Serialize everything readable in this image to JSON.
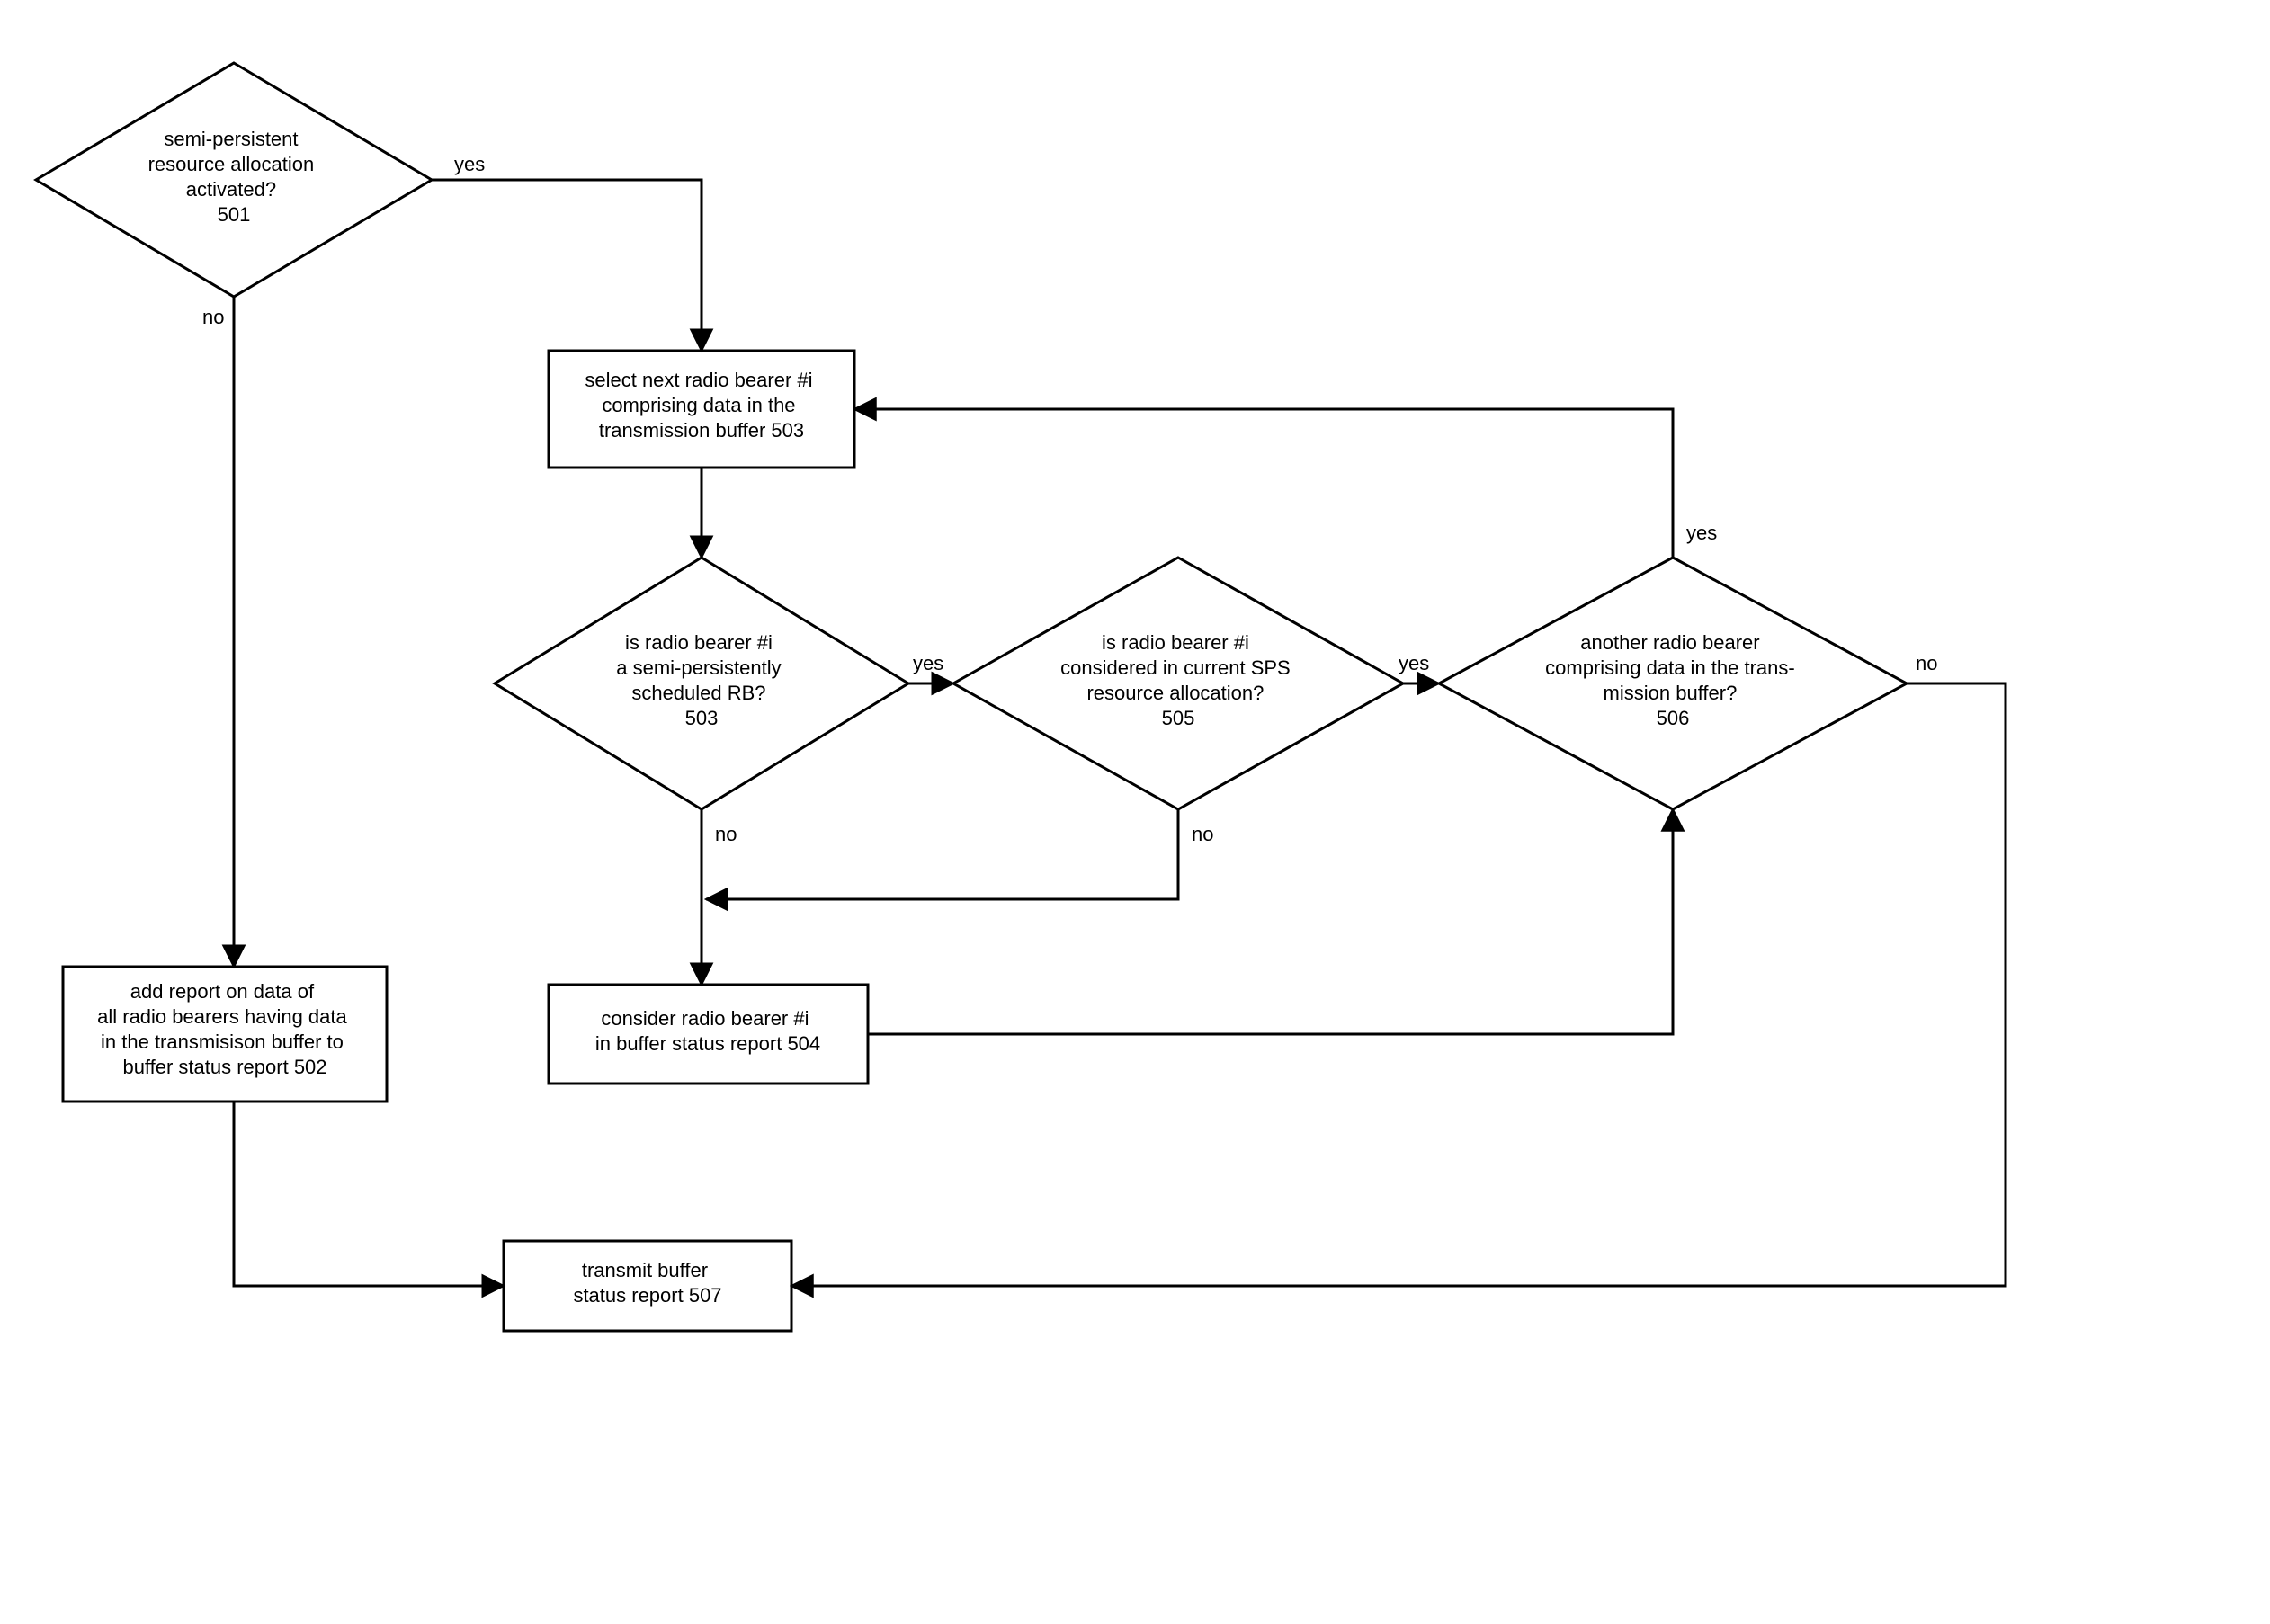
{
  "chart_data": {
    "type": "flowchart",
    "nodes": [
      {
        "id": "501",
        "shape": "diamond",
        "lines": [
          "semi-persistent",
          "resource allocation",
          "activated?",
          "501"
        ]
      },
      {
        "id": "502",
        "shape": "rect",
        "lines": [
          "add report on data of",
          "all radio bearers having data",
          "in the transmisison buffer to",
          "buffer status report 502"
        ]
      },
      {
        "id": "503p",
        "shape": "rect",
        "lines": [
          "select next radio bearer #i",
          "comprising data in the",
          "transmission buffer 503"
        ]
      },
      {
        "id": "503d",
        "shape": "diamond",
        "lines": [
          "is radio bearer #i",
          "a semi-persistently",
          "scheduled RB?",
          "503"
        ]
      },
      {
        "id": "505",
        "shape": "diamond",
        "lines": [
          "is radio bearer #i",
          "considered in current SPS",
          "resource allocation?",
          "505"
        ]
      },
      {
        "id": "506",
        "shape": "diamond",
        "lines": [
          "another radio bearer",
          "comprising data in the trans-",
          "mission buffer?",
          "506"
        ]
      },
      {
        "id": "504",
        "shape": "rect",
        "lines": [
          "consider radio bearer #i",
          "in buffer status report 504"
        ]
      },
      {
        "id": "507",
        "shape": "rect",
        "lines": [
          "transmit buffer",
          "status report 507"
        ]
      }
    ],
    "edges": [
      {
        "from": "501",
        "to": "503p",
        "label": "yes"
      },
      {
        "from": "501",
        "to": "502",
        "label": "no"
      },
      {
        "from": "502",
        "to": "507",
        "label": ""
      },
      {
        "from": "503p",
        "to": "503d",
        "label": ""
      },
      {
        "from": "503d",
        "to": "505",
        "label": "yes"
      },
      {
        "from": "503d",
        "to": "504",
        "label": "no"
      },
      {
        "from": "505",
        "to": "506",
        "label": "yes"
      },
      {
        "from": "505",
        "to": "504",
        "label": "no"
      },
      {
        "from": "504",
        "to": "506",
        "label": ""
      },
      {
        "from": "506",
        "to": "503p",
        "label": "yes"
      },
      {
        "from": "506",
        "to": "507",
        "label": "no"
      }
    ]
  },
  "labels": {
    "yes": "yes",
    "no": "no"
  }
}
